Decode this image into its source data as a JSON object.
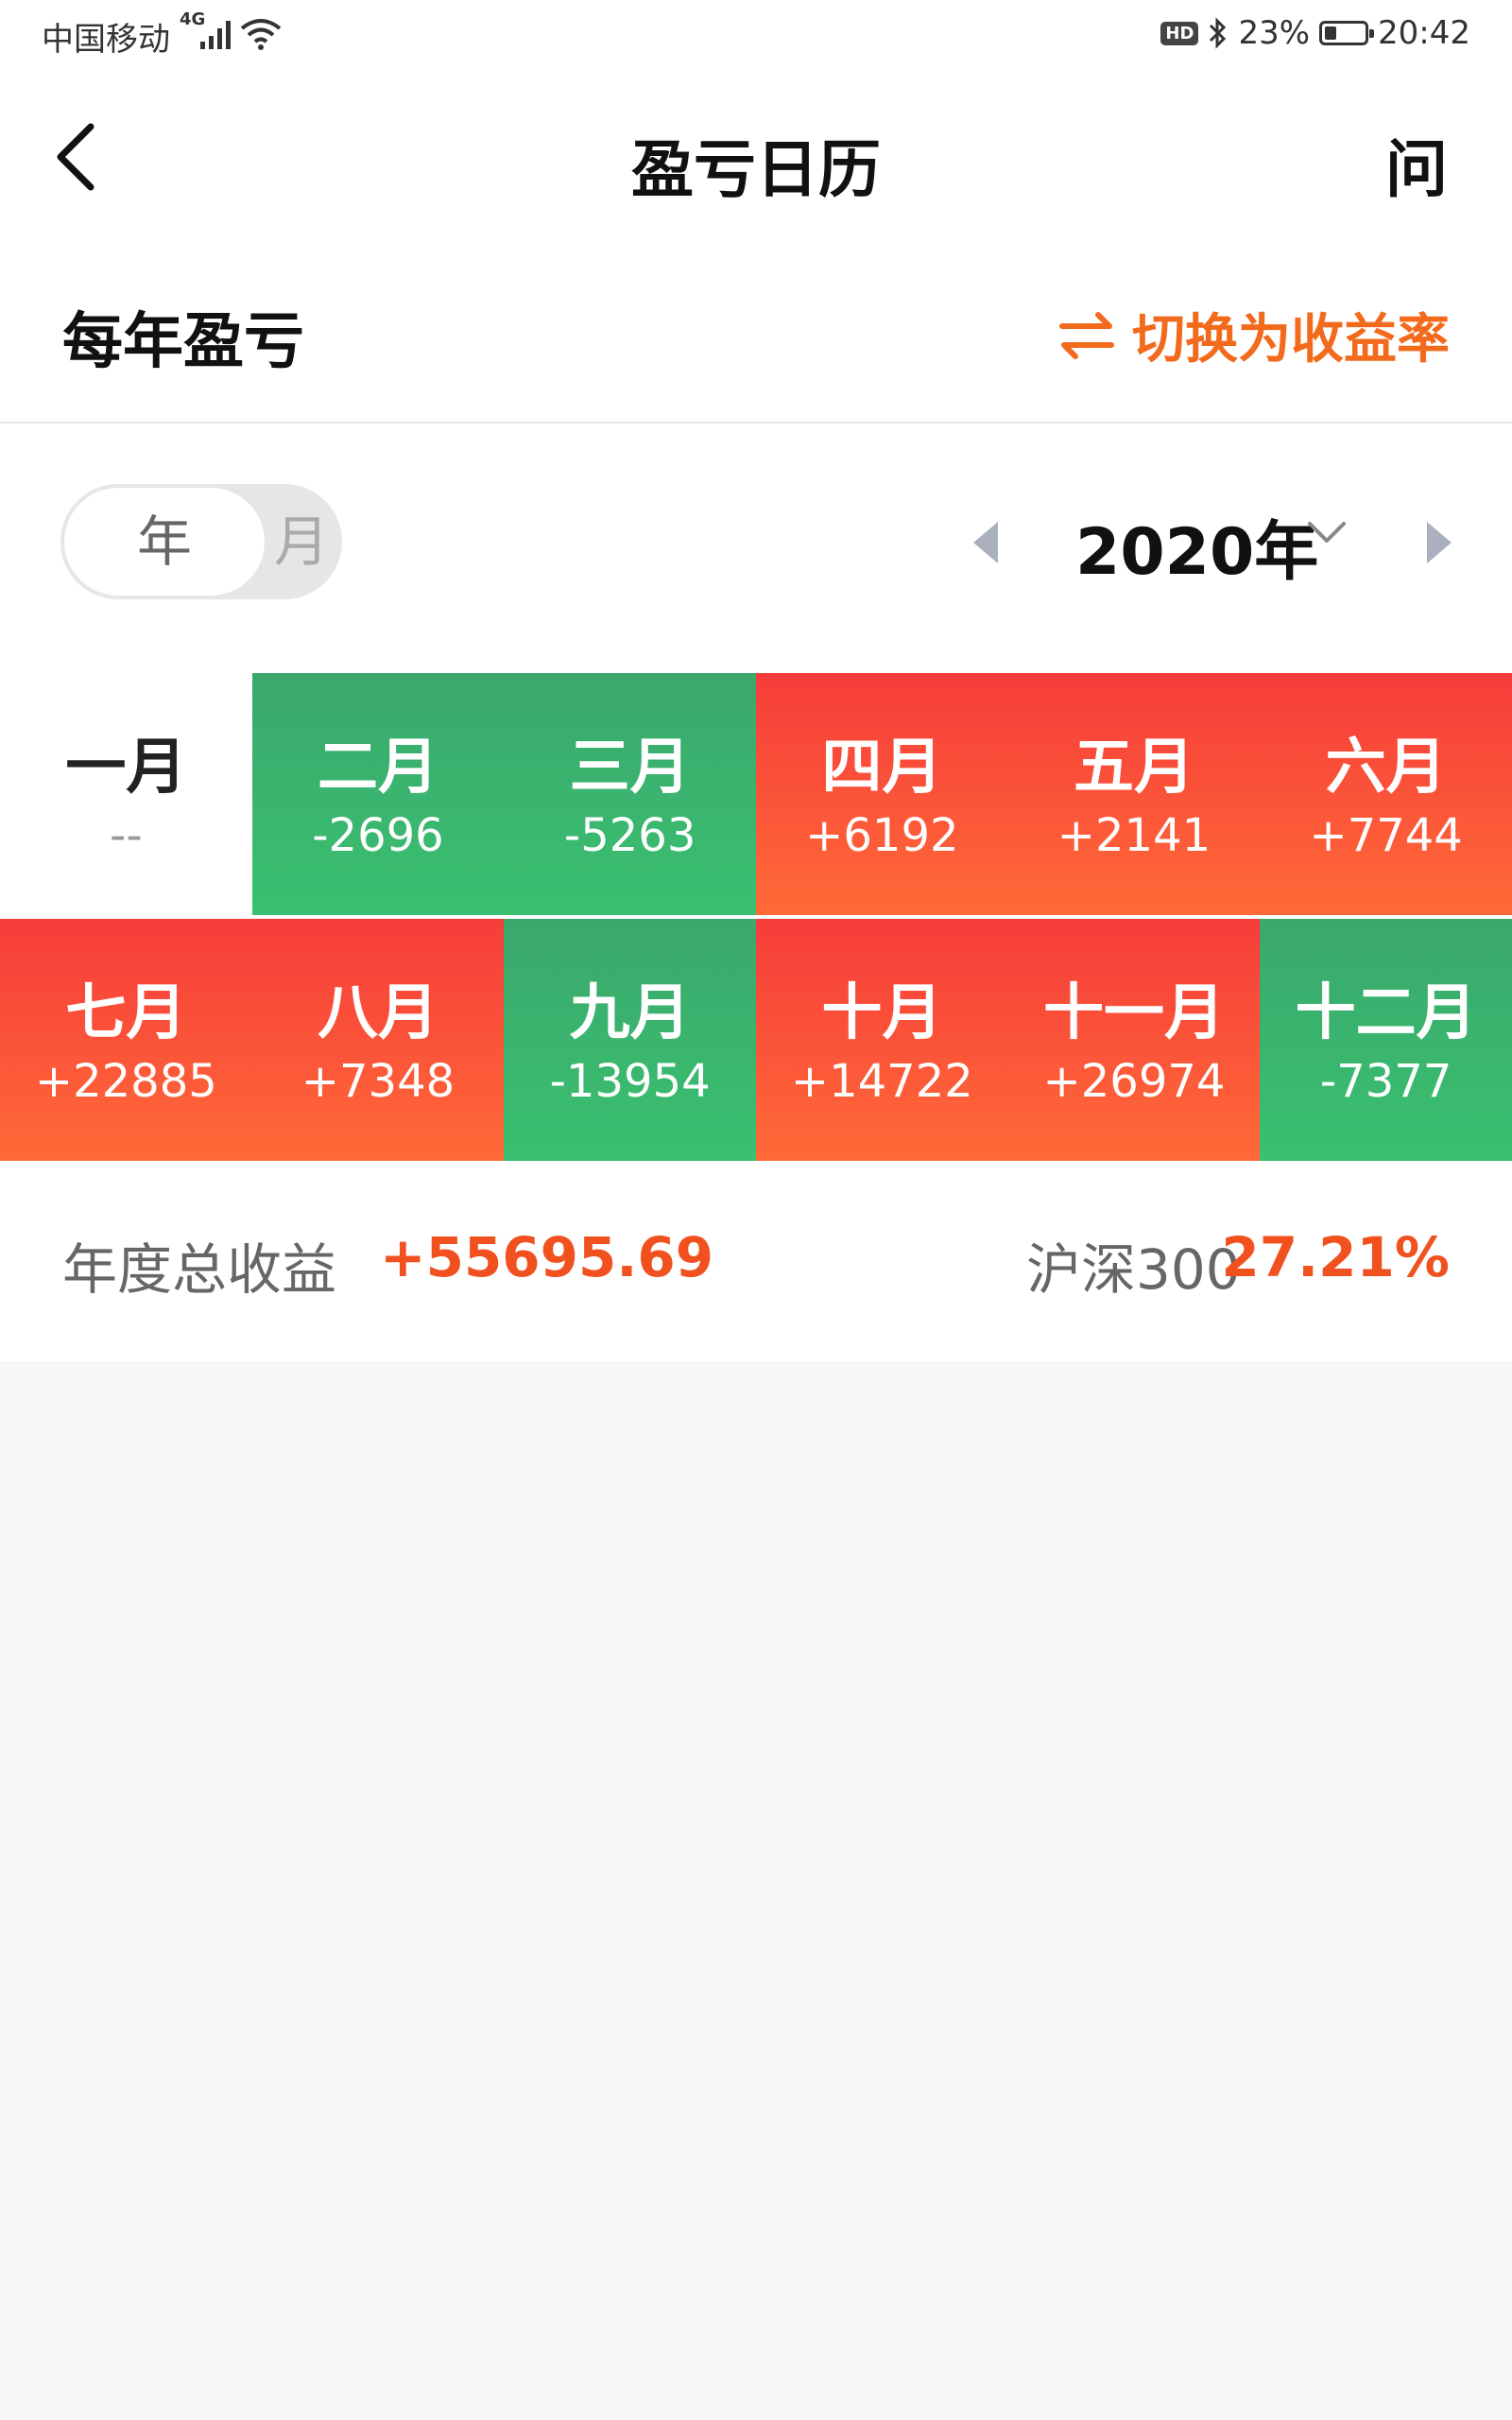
{
  "status_bar": {
    "carrier": "中国移动",
    "network": "4G",
    "hd": "HD",
    "battery": "23%",
    "time": "20:42"
  },
  "nav": {
    "title": "盈亏日历",
    "help": "问"
  },
  "section": {
    "title": "每年盈亏",
    "switch_label": "切换为收益率"
  },
  "period_toggle": {
    "year": "年",
    "month": "月",
    "selected": "年"
  },
  "year_selector": {
    "label": "2020年"
  },
  "months": [
    {
      "name": "一月",
      "value": "--",
      "state": "none"
    },
    {
      "name": "二月",
      "value": "-2696",
      "state": "loss"
    },
    {
      "name": "三月",
      "value": "-5263",
      "state": "loss"
    },
    {
      "name": "四月",
      "value": "+6192",
      "state": "gain"
    },
    {
      "name": "五月",
      "value": "+2141",
      "state": "gain"
    },
    {
      "name": "六月",
      "value": "+7744",
      "state": "gain"
    },
    {
      "name": "七月",
      "value": "+22885",
      "state": "gain"
    },
    {
      "name": "八月",
      "value": "+7348",
      "state": "gain"
    },
    {
      "name": "九月",
      "value": "-13954",
      "state": "loss"
    },
    {
      "name": "十月",
      "value": "+14722",
      "state": "gain"
    },
    {
      "name": "十一月",
      "value": "+26974",
      "state": "gain"
    },
    {
      "name": "十二月",
      "value": "-7377",
      "state": "loss"
    }
  ],
  "summary": {
    "label": "年度总收益",
    "value": "+55695.69",
    "benchmark_label": "沪深300",
    "benchmark_value": "27.21%"
  },
  "colors": {
    "gain": "#f63c3a",
    "loss": "#39b96e",
    "accent": "#f26b1d",
    "highlight_value": "#f0511f"
  }
}
